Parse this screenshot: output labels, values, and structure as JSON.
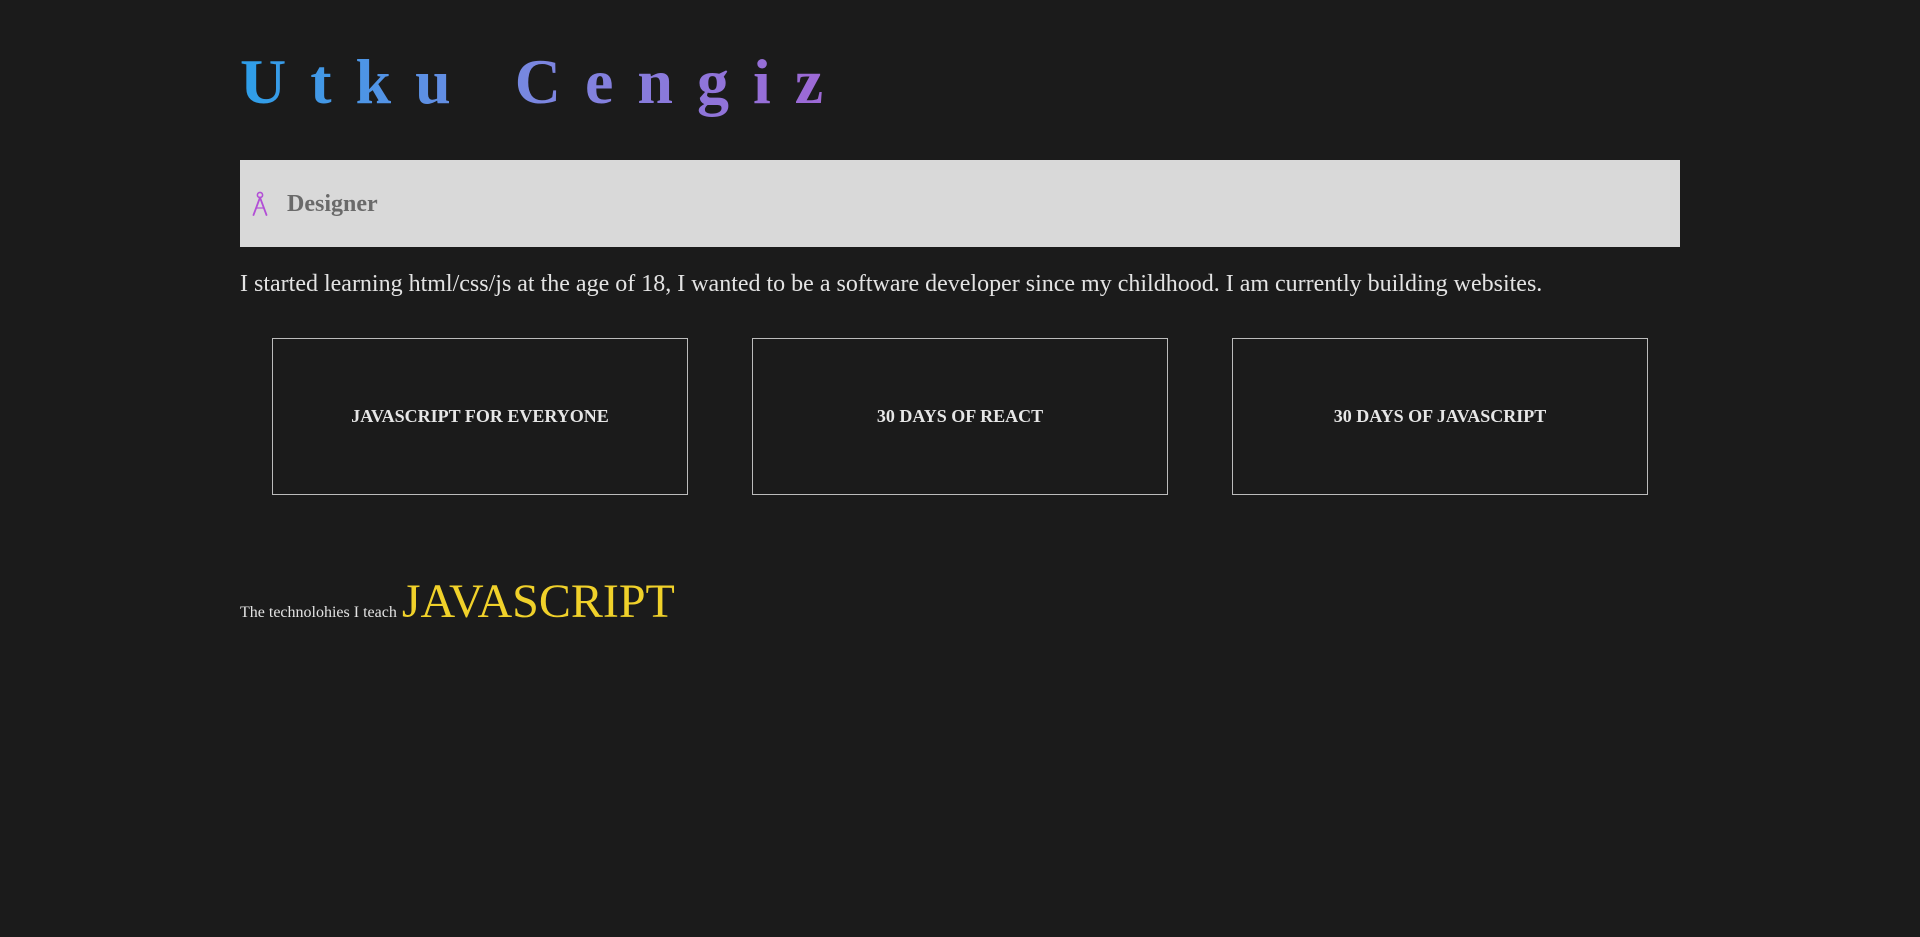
{
  "header": {
    "name": "Utku Cengiz",
    "gradient_colors": [
      "#2d9fe9",
      "#7c86e0",
      "#a066d4"
    ]
  },
  "role": {
    "icon": "compass-icon",
    "icon_color": "#b24fd6",
    "label": "Designer"
  },
  "intro": {
    "text": "I started learning html/css/js at the age of 18, I wanted to be a software developer since my childhood. I am currently building websites."
  },
  "cards": [
    {
      "label": "JAVASCRIPT FOR EVERYONE"
    },
    {
      "label": "30 DAYS OF REACT"
    },
    {
      "label": "30 DAYS OF JAVASCRIPT"
    }
  ],
  "tech": {
    "label": "The technolohies I teach",
    "current": "JAVASCRIPT",
    "current_color": "#f0d12a"
  }
}
